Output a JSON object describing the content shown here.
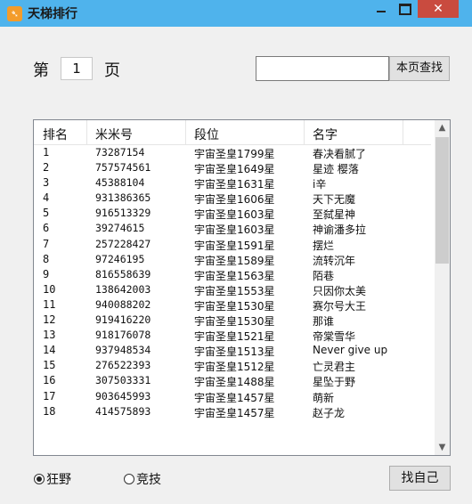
{
  "window": {
    "title": "天梯排行",
    "app_icon_glyph": "➴",
    "close_glyph": "✕"
  },
  "pager": {
    "prefix": "第",
    "page_value": "1",
    "suffix": "页"
  },
  "search": {
    "value": "",
    "button_label": "本页查找"
  },
  "table": {
    "headers": [
      "排名",
      "米米号",
      "段位",
      "名字"
    ],
    "rows": [
      [
        "1",
        "73287154",
        "宇宙圣皇1799星",
        "春决看腻了"
      ],
      [
        "2",
        "757574561",
        "宇宙圣皇1649星",
        "星迹 樱落"
      ],
      [
        "3",
        "45388104",
        "宇宙圣皇1631星",
        "i辛"
      ],
      [
        "4",
        "931386365",
        "宇宙圣皇1606星",
        "天下无魔"
      ],
      [
        "5",
        "916513329",
        "宇宙圣皇1603星",
        "至弑星神"
      ],
      [
        "6",
        "39274615",
        "宇宙圣皇1603星",
        "神谕潘多拉"
      ],
      [
        "7",
        "257228427",
        "宇宙圣皇1591星",
        "摆烂"
      ],
      [
        "8",
        "97246195",
        "宇宙圣皇1589星",
        "流转沉年"
      ],
      [
        "9",
        "816558639",
        "宇宙圣皇1563星",
        "陌巷"
      ],
      [
        "10",
        "138642003",
        "宇宙圣皇1553星",
        "只因你太美"
      ],
      [
        "11",
        "940088202",
        "宇宙圣皇1530星",
        "赛尔号大王"
      ],
      [
        "12",
        "919416220",
        "宇宙圣皇1530星",
        "那谁"
      ],
      [
        "13",
        "918176078",
        "宇宙圣皇1521星",
        "帝棠雪华"
      ],
      [
        "14",
        "937948534",
        "宇宙圣皇1513星",
        "Never give up"
      ],
      [
        "15",
        "276522393",
        "宇宙圣皇1512星",
        "亡灵君主"
      ],
      [
        "16",
        "307503331",
        "宇宙圣皇1488星",
        "星坠于野"
      ],
      [
        "17",
        "903645993",
        "宇宙圣皇1457星",
        "萌新"
      ],
      [
        "18",
        "414575893",
        "宇宙圣皇1457星",
        "赵子龙"
      ]
    ]
  },
  "mode": {
    "options": [
      "狂野",
      "竞技"
    ],
    "selected": "狂野"
  },
  "find_me_label": "找自己",
  "colors": {
    "titlebar": "#4fb3ec",
    "close": "#c94b3f",
    "background": "#f0f0f0"
  }
}
